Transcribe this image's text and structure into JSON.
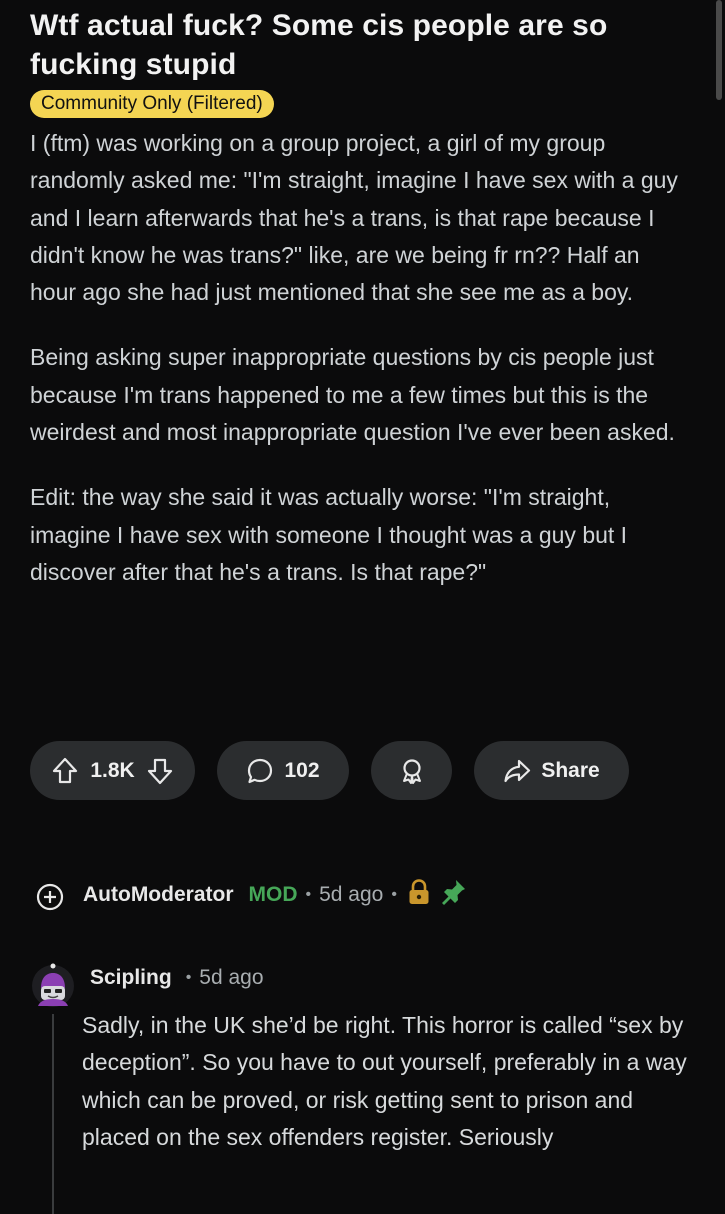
{
  "post": {
    "title": "Wtf actual fuck? Some cis people are so fucking stupid",
    "flair": "Community Only (Filtered)",
    "paragraphs": [
      "I (ftm) was working on a group project, a girl of my group randomly asked me: \"I'm straight, imagine I have sex with a guy and I learn afterwards that he's a trans, is that rape because I didn't know he was trans?\" like, are we being fr rn?? Half an hour ago she had just mentioned that she see me as a boy.",
      "Being asking super inappropriate questions by cis people just because I'm trans happened to me a few times but this is the weirdest and most inappropriate question I've ever been asked.",
      "Edit: the way she said it was actually worse: \"I'm straight, imagine I have sex with someone I thought was a guy but I discover after that he's a trans. Is that rape?\""
    ]
  },
  "actions": {
    "vote_count": "1.8K",
    "comment_count": "102",
    "share_label": "Share"
  },
  "automod": {
    "username": "AutoModerator",
    "tag": "MOD",
    "time": "5d ago",
    "separator": "•"
  },
  "comment": {
    "username": "Scipling",
    "time": "5d ago",
    "separator": "•",
    "text": "Sadly, in the UK she’d be right. This horror is called “sex by deception”. So you have to out yourself, preferably in a way which can be proved, or risk getting sent to prison and placed on the sex offenders register. Seriously"
  },
  "colors": {
    "background": "#0b0b0c",
    "flair_bg": "#f4d553",
    "button_bg": "#2b2d2f",
    "mod_green": "#46a758",
    "lock_gold": "#c9962c"
  },
  "icons": [
    "upvote-icon",
    "downvote-icon",
    "comment-icon",
    "award-icon",
    "share-icon",
    "expand-icon",
    "lock-icon",
    "pin-icon"
  ]
}
